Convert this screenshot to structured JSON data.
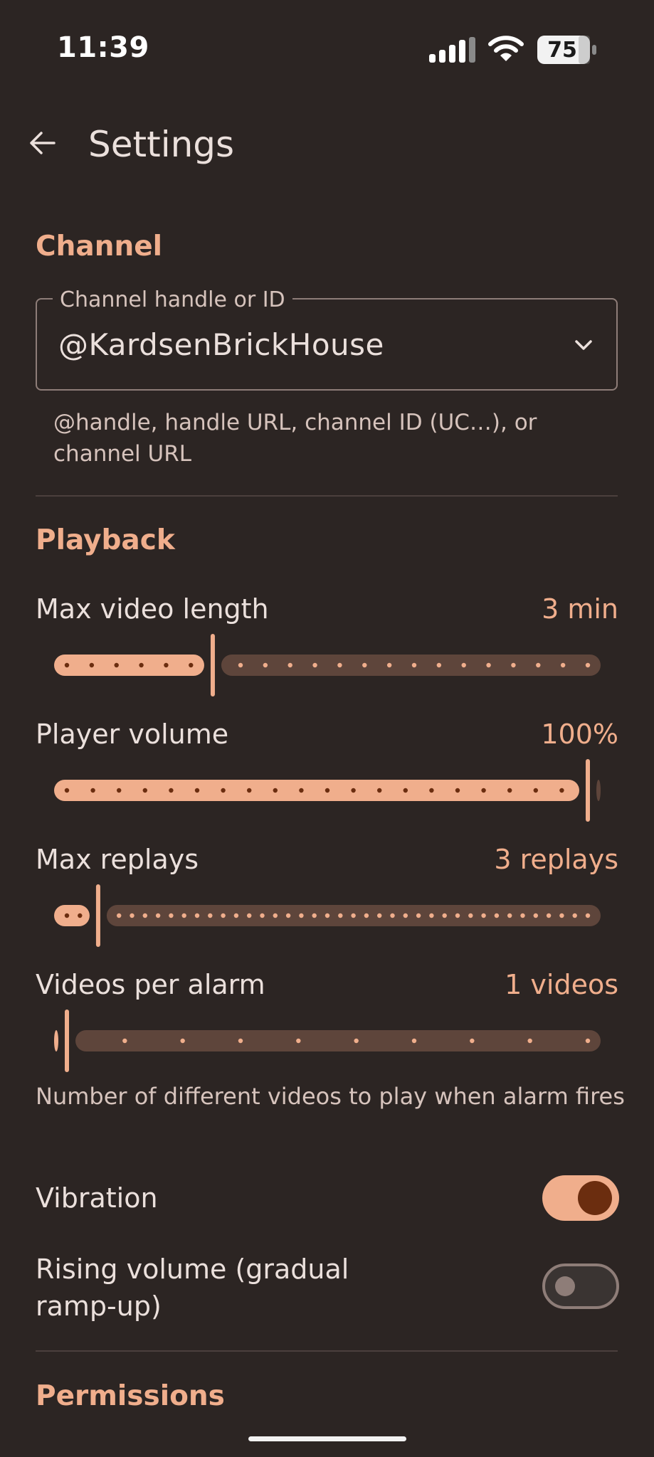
{
  "status": {
    "time": "11:39",
    "battery": "75"
  },
  "header": {
    "title": "Settings"
  },
  "channel": {
    "section": "Channel",
    "field_label": "Channel handle or ID",
    "field_value": "@KardsenBrickHouse",
    "help": "@handle, handle URL, channel ID (UC…), or channel URL"
  },
  "playback": {
    "section": "Playback",
    "sliders": [
      {
        "label": "Max video length",
        "value_text": "3 min",
        "fraction": 0.28,
        "ticks": 21
      },
      {
        "label": "Player volume",
        "value_text": "100%",
        "fraction": 1.0,
        "ticks": 20
      },
      {
        "label": "Max replays",
        "value_text": "3 replays",
        "fraction": 0.06,
        "ticks": 40
      },
      {
        "label": "Videos per alarm",
        "value_text": "1 videos",
        "fraction": 0.0,
        "ticks": 9
      }
    ],
    "videos_desc": "Number of different videos to play when alarm fires",
    "vibration": {
      "label": "Vibration",
      "on": true
    },
    "rising": {
      "label": "Rising volume (gradual ramp-up)",
      "on": false
    }
  },
  "permissions": {
    "section": "Permissions"
  },
  "colors": {
    "background": "#2c2523",
    "accent": "#f0ae8c",
    "track_inactive": "#5e453b",
    "text": "#ebe0dc"
  }
}
